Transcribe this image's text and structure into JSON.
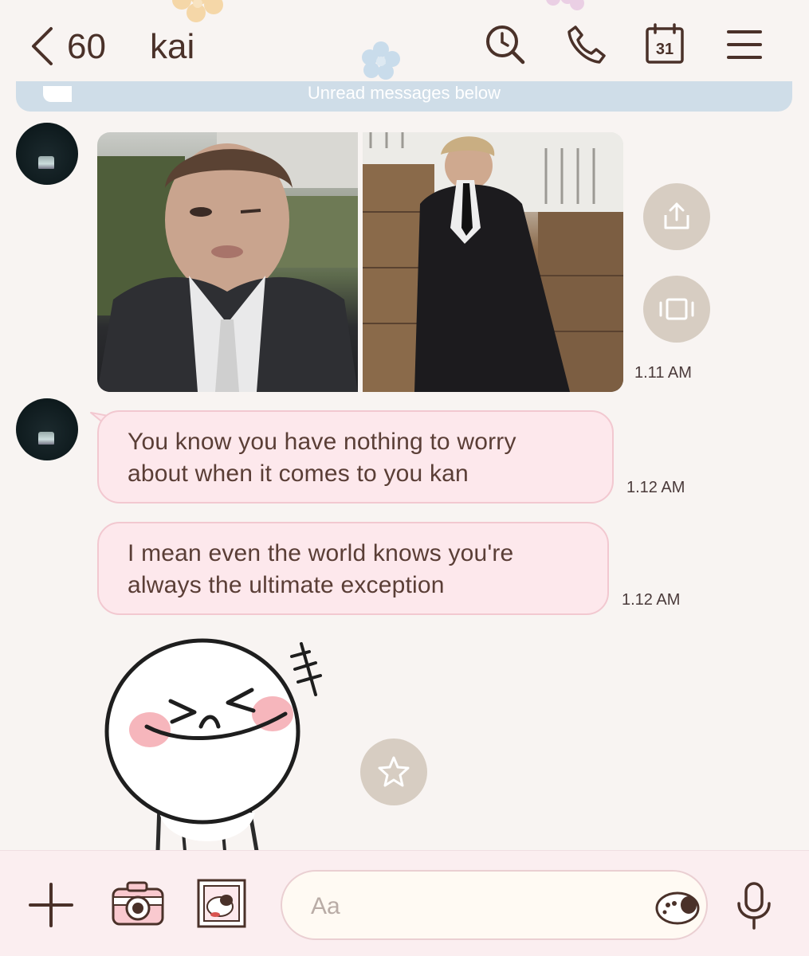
{
  "header": {
    "unread_count": "60",
    "title": "kai",
    "calendar_day": "31",
    "icons": [
      "back-chevron-icon",
      "search-icon",
      "phone-icon",
      "calendar-icon",
      "menu-icon"
    ]
  },
  "unread_banner": {
    "text": "Unread messages below"
  },
  "messages": [
    {
      "type": "photos",
      "time": "1.11 AM"
    },
    {
      "type": "text",
      "text": "You know you have nothing to worry about when it comes to you kan",
      "time": "1.12 AM"
    },
    {
      "type": "text",
      "text": "I mean even the world knows you're always the ultimate exception",
      "time": "1.12 AM"
    },
    {
      "type": "sticker"
    }
  ],
  "input_bar": {
    "placeholder": "Aa",
    "icons": [
      "plus-icon",
      "camera-icon",
      "gallery-icon",
      "emoji-sticker-icon",
      "microphone-icon"
    ]
  },
  "colors": {
    "background": "#f8f4f2",
    "header_text": "#4a3129",
    "bubble_fill": "#fde8ec",
    "bubble_border": "#f2c8d0",
    "banner": "#cfdde8",
    "action_button": "#d7cdc2",
    "input_bar": "#fbeef0"
  }
}
